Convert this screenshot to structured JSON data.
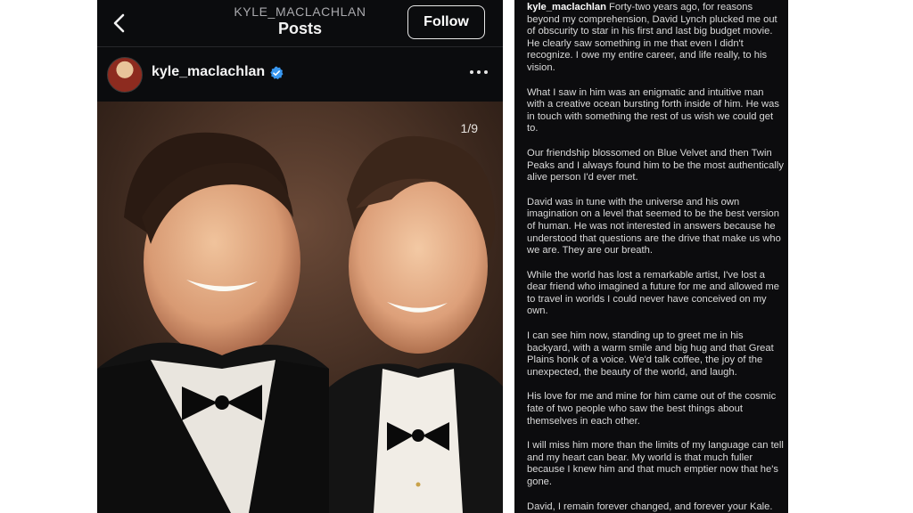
{
  "header": {
    "handle": "KYLE_MACLACHLAN",
    "title": "Posts",
    "follow_label": "Follow"
  },
  "post": {
    "username": "kyle_maclachlan",
    "image_counter": "1/9"
  },
  "caption": {
    "username": "kyle_maclachlan",
    "paragraphs": [
      "Forty-two years ago, for reasons beyond my comprehension, David Lynch plucked me out of obscurity to star in his first and last big budget movie. He clearly saw something in me that even I didn't recognize. I owe my entire career, and life really, to his vision.",
      "What I saw in him was an enigmatic and intuitive man with a creative ocean bursting forth inside of him. He was in touch with something the rest of us wish we could get to.",
      "Our friendship blossomed on Blue Velvet and then Twin Peaks and I always found him to be the most authentically alive person I'd ever met.",
      "David was in tune with the universe and his own imagination on a level that seemed to be the best version of human. He was not interested in answers because he understood that questions are the drive that make us who we are. They are our breath.",
      "While the world has lost a remarkable artist, I've lost a dear friend who imagined a future for me and allowed me to travel in worlds I could never have conceived on my own.",
      "I can see him now, standing up to greet me in his backyard, with a warm smile and big hug and that Great Plains honk of a voice. We'd talk coffee, the joy of the unexpected, the beauty of the world, and laugh.",
      "His love for me and mine for him came out of the cosmic fate of two people who saw the best things about themselves in each other.",
      "I will miss him more than the limits of my language can tell and my heart can bear. My world is that much fuller because I knew him and that much emptier now that he's gone.",
      "David, I remain forever changed, and forever your Kale. Thank you for everything."
    ]
  },
  "colors": {
    "background": "#0b0c0e",
    "verified_blue": "#3897f0",
    "text_primary": "#f5f5f5",
    "text_secondary": "#a9a9ad"
  },
  "icons": [
    "back-chevron-icon",
    "verified-badge-icon",
    "more-options-icon"
  ]
}
